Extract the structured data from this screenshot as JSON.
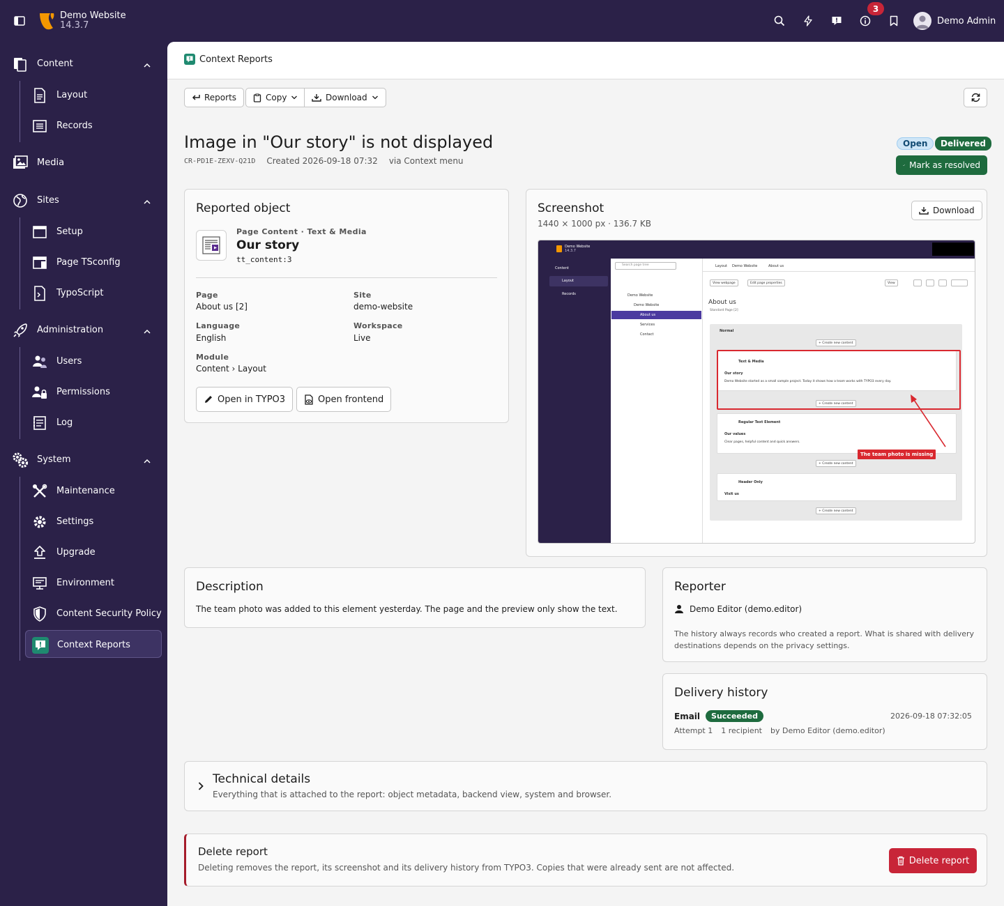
{
  "topbar": {
    "site_name": "Demo Website",
    "site_version": "14.3.7",
    "notification_count": "3",
    "user_name": "Demo Admin",
    "icons": [
      "search-icon",
      "bolt-icon",
      "report-icon",
      "info-icon",
      "bookmark-icon"
    ]
  },
  "sidebar": {
    "groups": [
      {
        "label": "Content",
        "icon": "content-icon",
        "items": [
          {
            "label": "Layout",
            "icon": "layout-icon"
          },
          {
            "label": "Records",
            "icon": "records-icon"
          }
        ]
      },
      {
        "label": "Media",
        "icon": "media-icon",
        "items": []
      },
      {
        "label": "Sites",
        "icon": "sites-icon",
        "items": [
          {
            "label": "Setup",
            "icon": "setup-icon"
          },
          {
            "label": "Page TSconfig",
            "icon": "tsconfig-icon"
          },
          {
            "label": "TypoScript",
            "icon": "typoscript-icon"
          }
        ]
      },
      {
        "label": "Administration",
        "icon": "administration-icon",
        "items": [
          {
            "label": "Users",
            "icon": "users-icon"
          },
          {
            "label": "Permissions",
            "icon": "permissions-icon"
          },
          {
            "label": "Log",
            "icon": "log-icon"
          }
        ]
      },
      {
        "label": "System",
        "icon": "system-icon",
        "items": [
          {
            "label": "Maintenance",
            "icon": "maintenance-icon"
          },
          {
            "label": "Settings",
            "icon": "settings-icon"
          },
          {
            "label": "Upgrade",
            "icon": "upgrade-icon"
          },
          {
            "label": "Environment",
            "icon": "environment-icon"
          },
          {
            "label": "Content Security Policy",
            "icon": "shield-icon"
          },
          {
            "label": "Context Reports",
            "icon": "context-reports-icon"
          }
        ]
      }
    ],
    "active": "Context Reports"
  },
  "header": {
    "breadcrumb": "Context Reports"
  },
  "toolbar": {
    "reports_label": "Reports",
    "copy_label": "Copy",
    "download_label": "Download"
  },
  "report": {
    "title": "Image in \"Our story\" is not displayed",
    "id": "CR-PD1E-ZEXV-Q21D",
    "created": "Created 2026-09-18 07:32",
    "via": "via Context menu",
    "status_open": "Open",
    "status_delivered": "Delivered",
    "resolve_label": "Mark as resolved"
  },
  "reported_object": {
    "heading": "Reported object",
    "type": "Page Content · Text & Media",
    "name": "Our story",
    "record_id": "tt_content:3",
    "fields": {
      "page_label": "Page",
      "page_value": "About us [2]",
      "site_label": "Site",
      "site_value": "demo-website",
      "language_label": "Language",
      "language_value": "English",
      "workspace_label": "Workspace",
      "workspace_value": "Live",
      "module_label": "Module",
      "module_value": "Content › Layout"
    },
    "open_typo3_label": "Open in TYPO3",
    "open_frontend_label": "Open frontend"
  },
  "screenshot": {
    "heading": "Screenshot",
    "info": "1440 × 1000 px · 136.7 KB",
    "download_label": "Download",
    "preview": {
      "site_name": "Demo Website",
      "site_version": "14.3.7",
      "nav_content": "Content",
      "nav_layout": "Layout",
      "nav_records": "Records",
      "search_placeholder": "Search page tree",
      "tree": [
        "Demo Website",
        "Demo Website",
        "About us",
        "Services",
        "Contact"
      ],
      "crumbs": [
        "Layout",
        "Demo Website",
        "About us"
      ],
      "view_webpage": "View webpage",
      "edit_page": "Edit page properties",
      "view": "View",
      "page_title": "About us",
      "page_type": "Standard Page [2]",
      "column": "Normal",
      "create_new": "+ Create new content",
      "el1_type": "Text & Media",
      "el1_title": "Our story",
      "el1_text": "Demo Website started as a small sample project. Today it shows how a team works with TYPO3 every day.",
      "el2_type": "Regular Text Element",
      "el2_title": "Our values",
      "el2_text": "Clear pages, helpful content and quick answers.",
      "el3_type": "Header Only",
      "el3_title": "Visit us",
      "annotation": "The team photo is missing"
    }
  },
  "description": {
    "heading": "Description",
    "text": "The team photo was added to this element yesterday. The page and the preview only show the text."
  },
  "reporter": {
    "heading": "Reporter",
    "name": "Demo Editor (demo.editor)",
    "note": "The history always records who created a report. What is shared with delivery destinations depends on the privacy settings."
  },
  "delivery": {
    "heading": "Delivery history",
    "channel": "Email",
    "status": "Succeeded",
    "timestamp": "2026-09-18 07:32:05",
    "attempt": "Attempt 1",
    "recipients": "1 recipient",
    "by": "by Demo Editor (demo.editor)"
  },
  "technical": {
    "heading": "Technical details",
    "text": "Everything that is attached to the report: object metadata, backend view, system and browser."
  },
  "delete": {
    "heading": "Delete report",
    "text": "Deleting removes the report, its screenshot and its delivery history from TYPO3. Copies that were already sent are not affected.",
    "button_label": "Delete report"
  }
}
